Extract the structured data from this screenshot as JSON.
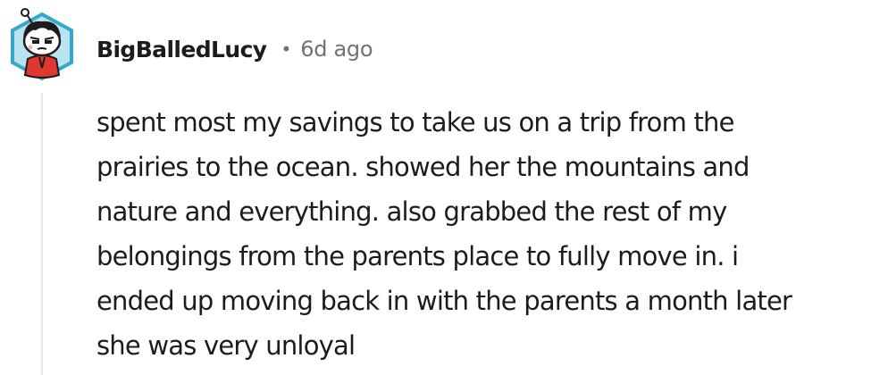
{
  "comment": {
    "author": "BigBalledLucy",
    "separator": "•",
    "timestamp": "6d ago",
    "avatar_icon": "snoo-avatar-icon",
    "body_lines": [
      "spent most my savings to take us on a trip from the",
      "prairies to the ocean. showed her the mountains and",
      "nature and everything. also grabbed the rest of my",
      "belongings from the parents place to fully move in. i",
      "ended up moving back in with the parents a month later",
      "she was very unloyal"
    ]
  },
  "colors": {
    "text": "#1c1c1c",
    "meta": "#6c7378",
    "thread_line": "#e4e6e8",
    "avatar_border": "#33a8c9",
    "avatar_shirt": "#e0382e"
  }
}
